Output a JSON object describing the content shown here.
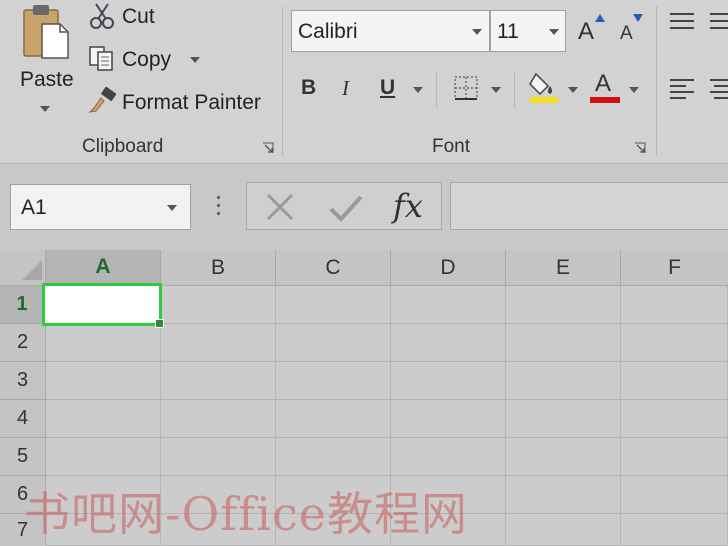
{
  "clipboard": {
    "paste_label": "Paste",
    "cut_label": "Cut",
    "copy_label": "Copy",
    "format_painter_label": "Format Painter",
    "group_label": "Clipboard"
  },
  "font": {
    "font_name": "Calibri",
    "font_size": "11",
    "bold": "B",
    "italic": "I",
    "underline": "U",
    "grow_font": "A",
    "shrink_font": "A",
    "font_color_letter": "A",
    "group_label": "Font"
  },
  "formula_bar": {
    "name_box": "A1",
    "fx": "fx",
    "formula_value": ""
  },
  "grid": {
    "columns": [
      "A",
      "B",
      "C",
      "D",
      "E",
      "F"
    ],
    "rows": [
      "1",
      "2",
      "3",
      "4",
      "5",
      "6",
      "7"
    ],
    "selected_cell": "A1"
  },
  "colors": {
    "selection": "#2ecc40",
    "fill_color": "#f0e020",
    "font_color": "#d01010"
  },
  "watermark": "书吧网-Office教程网"
}
